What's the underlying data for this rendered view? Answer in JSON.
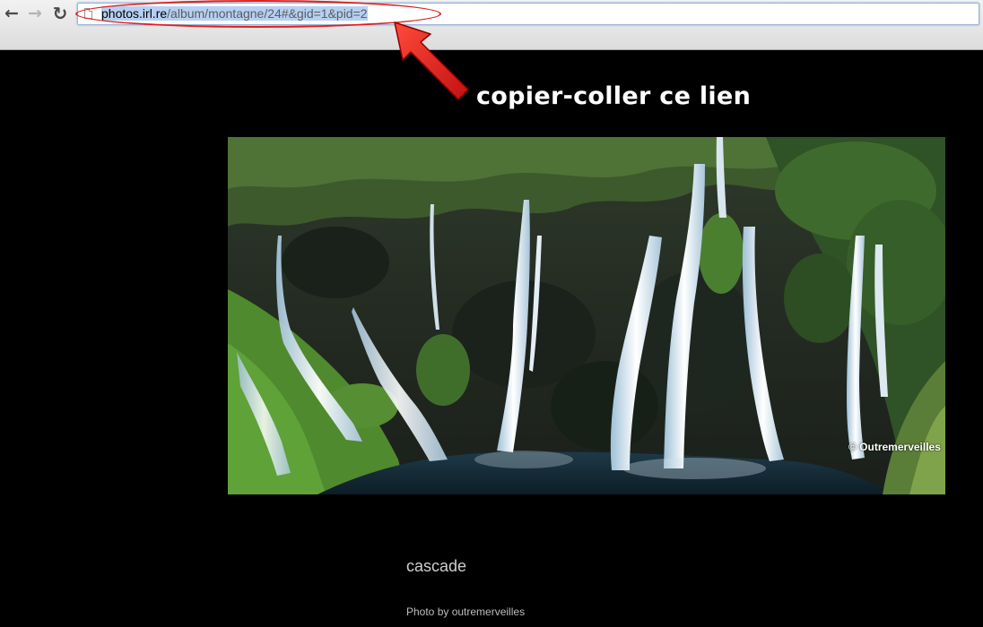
{
  "browser": {
    "toolbar": {
      "back_icon": "back-arrow-icon",
      "forward_icon": "forward-arrow-icon",
      "reload_icon": "reload-icon",
      "back_glyph": "←",
      "forward_glyph": "→",
      "reload_glyph": "↻"
    },
    "address_bar": {
      "url_host": "photos.irl.re",
      "url_path": "/album/montagne/24#&gid=1&pid=2",
      "page_icon": "page-icon",
      "selected": true
    }
  },
  "annotation": {
    "caption": "copier-coller ce lien",
    "color": "#e02020"
  },
  "photo": {
    "subject": "waterfall",
    "watermark": "© Outremerveilles"
  },
  "caption": {
    "title": "cascade",
    "credit": "Photo by outremerveilles"
  },
  "colors": {
    "page_background": "#000000",
    "selection_highlight": "#b5d0f2",
    "annotation_red": "#e02020"
  }
}
